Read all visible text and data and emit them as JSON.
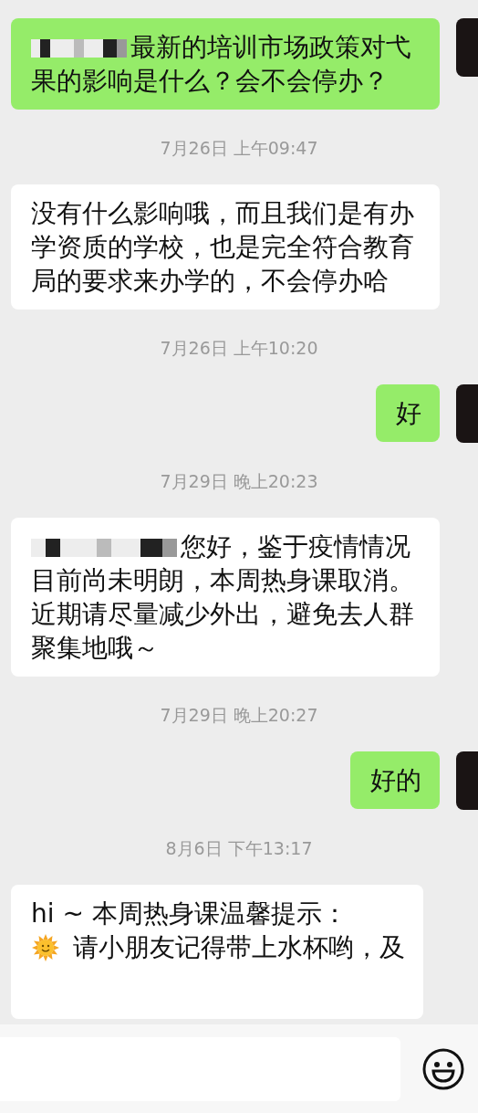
{
  "messages": [
    {
      "kind": "sent",
      "redacted": true,
      "text": "最新的培训市场政策对弋果的影响是什么？会不会停办？"
    },
    {
      "kind": "time",
      "text": "7月26日 上午09:47"
    },
    {
      "kind": "received",
      "text": "没有什么影响哦，而且我们是有办学资质的学校，也是完全符合教育局的要求来办学的，不会停办哈"
    },
    {
      "kind": "time",
      "text": "7月26日 上午10:20"
    },
    {
      "kind": "sent",
      "text": "好"
    },
    {
      "kind": "time",
      "text": "7月29日 晚上20:23"
    },
    {
      "kind": "received",
      "redacted": true,
      "text": "您好，鉴于疫情情况目前尚未明朗，本周热身课取消。近期请尽量减少外出，避免去人群聚集地哦～"
    },
    {
      "kind": "time",
      "text": "7月29日 晚上20:27"
    },
    {
      "kind": "sent",
      "text": "好的"
    },
    {
      "kind": "time",
      "text": "8月6日 下午13:17"
    },
    {
      "kind": "received",
      "cut": true,
      "lines": [
        {
          "kind": "plain",
          "text": "hi ~ 本周热身课温馨提示："
        },
        {
          "kind": "sun",
          "text": "请小朋友记得带上水杯哟，及"
        }
      ]
    }
  ]
}
